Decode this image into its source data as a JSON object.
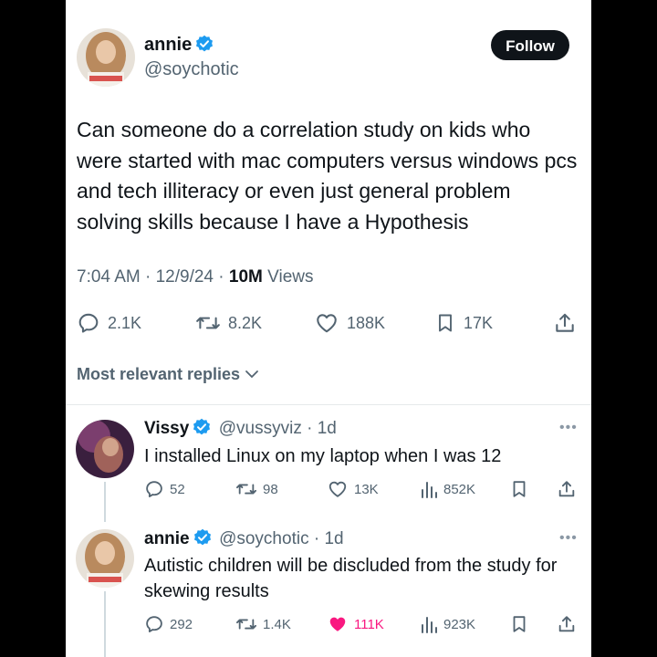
{
  "tweet": {
    "author_name": "annie",
    "author_handle": "@soychotic",
    "follow_label": "Follow",
    "text": "Can someone do a correlation study on kids who were started with mac computers versus windows pcs and tech illiteracy or even just general problem solving skills because I have a Hypothesis",
    "time": "7:04 AM",
    "date": "12/9/24",
    "separator": "·",
    "views_count": "10M",
    "views_label": "Views",
    "stats": {
      "replies": "2.1K",
      "retweets": "8.2K",
      "likes": "188K",
      "bookmarks": "17K"
    }
  },
  "replies_filter": {
    "label": "Most relevant replies"
  },
  "replies": [
    {
      "name": "Vissy",
      "handle_time": "@vussyviz · 1d",
      "text": "I installed Linux on my laptop when I was 12",
      "stats": {
        "replies": "52",
        "retweets": "98",
        "likes": "13K",
        "views": "852K"
      },
      "liked": false
    },
    {
      "name": "annie",
      "handle_time": "@soychotic · 1d",
      "text": "Autistic children will be discluded from the study for skewing results",
      "stats": {
        "replies": "292",
        "retweets": "1.4K",
        "likes": "111K",
        "views": "923K"
      },
      "liked": true
    }
  ],
  "colors": {
    "verified": "#1d9bf0",
    "liked": "#f91880",
    "muted": "#536471"
  },
  "icons": [
    "verified-badge-icon",
    "reply-icon",
    "retweet-icon",
    "like-icon",
    "bookmark-icon",
    "share-icon",
    "views-icon",
    "chevron-down-icon",
    "more-icon"
  ]
}
